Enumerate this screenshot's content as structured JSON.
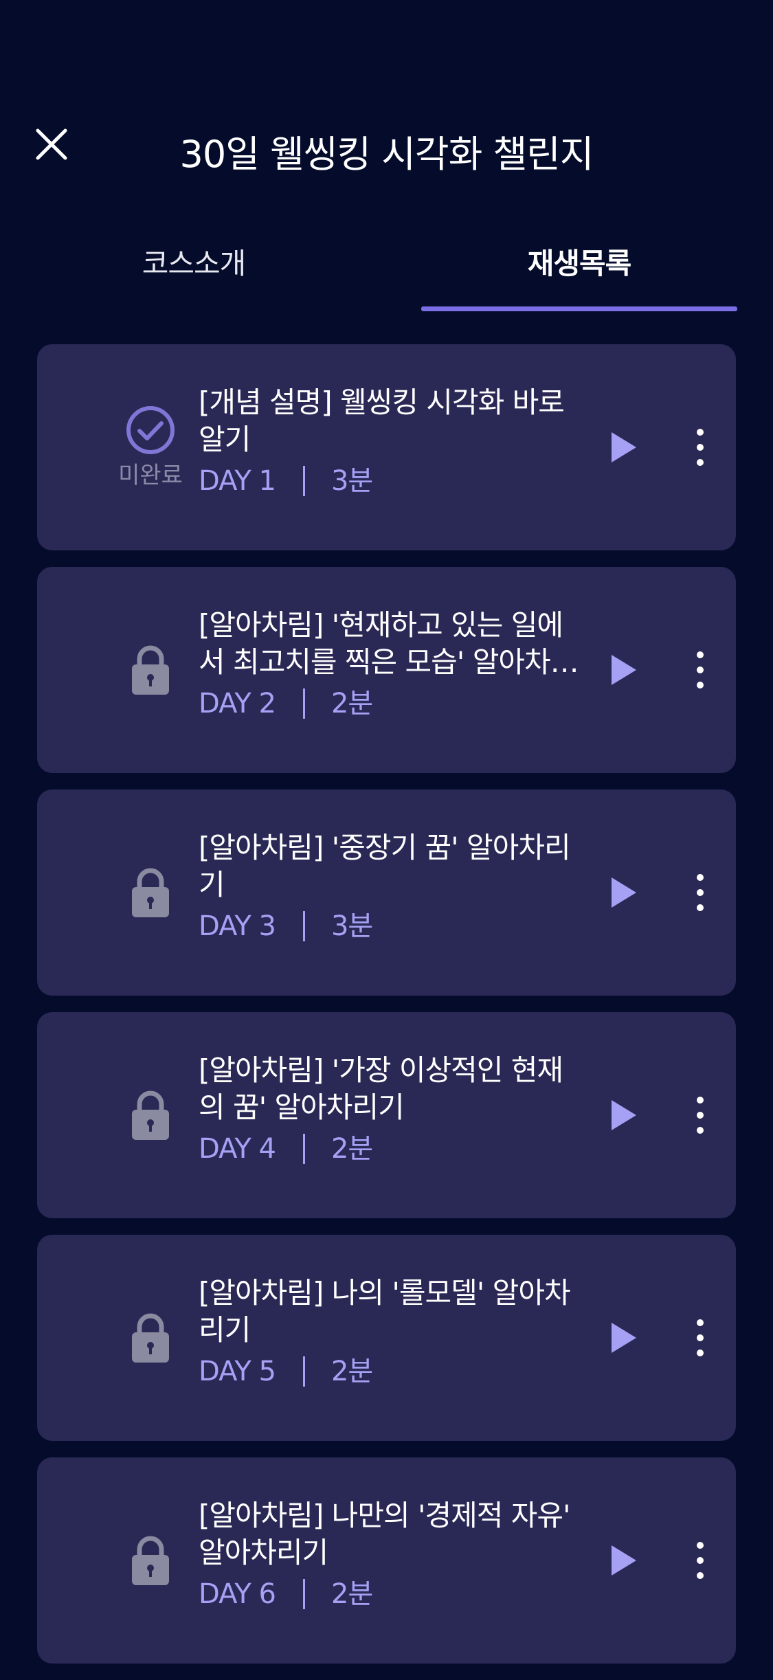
{
  "header": {
    "title": "30일 웰씽킹 시각화 챌린지",
    "close_icon": "close-icon"
  },
  "tabs": [
    {
      "label": "코스소개",
      "active": false
    },
    {
      "label": "재생목록",
      "active": true
    }
  ],
  "colors": {
    "background": "#050c2b",
    "card": "#2a2855",
    "accent": "#7b6ee6",
    "meta": "#a6a1f4",
    "muted": "#8b8aa8"
  },
  "episodes": [
    {
      "title": "[개념 설명] 웰씽킹 시각화 바로 알기",
      "day": "DAY 1",
      "duration": "3분",
      "status_icon": "check-circle-icon",
      "status_text": "미완료"
    },
    {
      "title": "[알아차림] '현재하고 있는 일에서 최고치를 찍은 모습' 알아차리기",
      "day": "DAY 2",
      "duration": "2분",
      "status_icon": "lock-icon"
    },
    {
      "title": "[알아차림] '중장기 꿈' 알아차리기",
      "day": "DAY 3",
      "duration": "3분",
      "status_icon": "lock-icon"
    },
    {
      "title": "[알아차림] '가장 이상적인 현재의 꿈' 알아차리기",
      "day": "DAY 4",
      "duration": "2분",
      "status_icon": "lock-icon"
    },
    {
      "title": "[알아차림] 나의 '롤모델' 알아차리기",
      "day": "DAY 5",
      "duration": "2분",
      "status_icon": "lock-icon"
    },
    {
      "title": "[알아차림] 나만의 '경제적 자유' 알아차리기",
      "day": "DAY 6",
      "duration": "2분",
      "status_icon": "lock-icon"
    }
  ]
}
